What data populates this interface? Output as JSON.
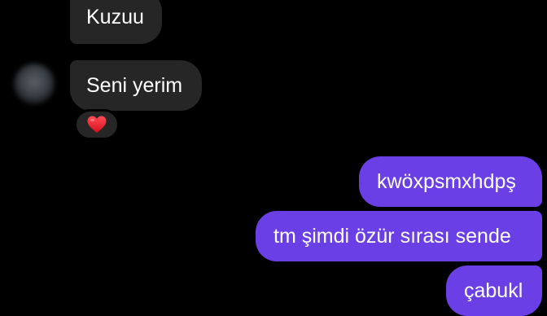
{
  "conversation": {
    "incoming_messages": [
      {
        "text": "Kuzuu"
      },
      {
        "text": "Seni yerim"
      }
    ],
    "reaction": {
      "icon": "red-heart-icon",
      "color": "#e3202c"
    },
    "outgoing_messages": [
      {
        "text": "kwöxpsmxhdpş"
      },
      {
        "text": "tm şimdi özür sırası sende"
      },
      {
        "text": "çabukl"
      }
    ],
    "colors": {
      "incoming_bubble": "#262626",
      "outgoing_bubble": "#6a3fe6",
      "background": "#000000"
    }
  }
}
